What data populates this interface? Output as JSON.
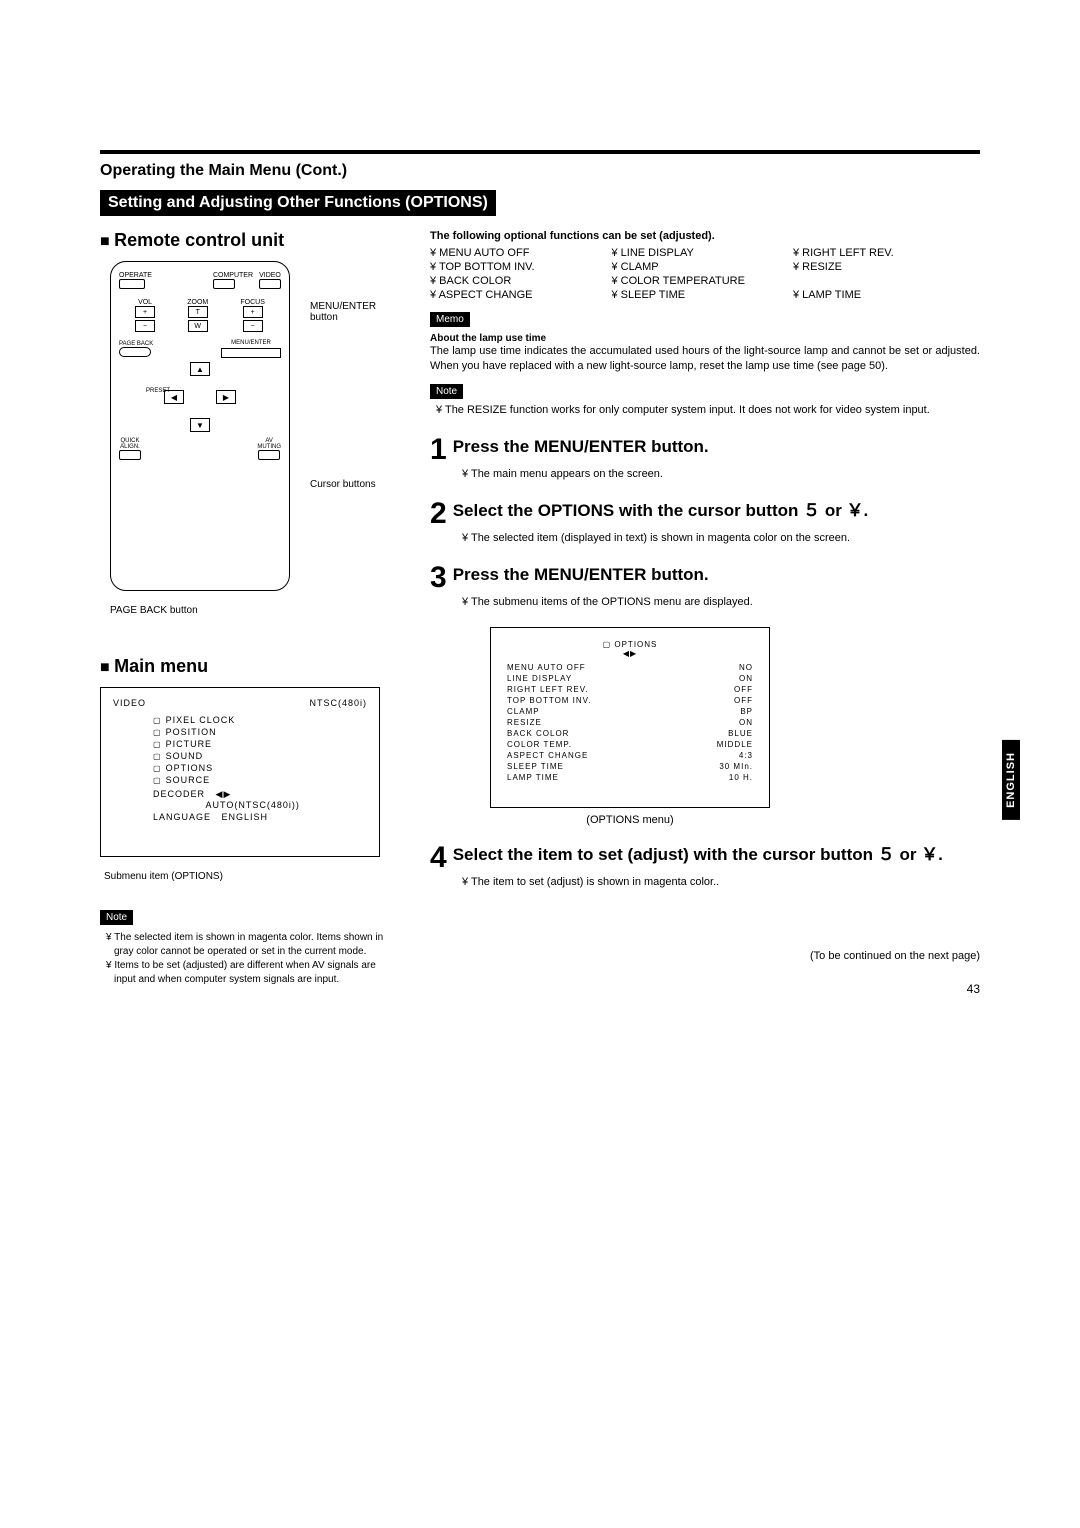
{
  "header": {
    "section_title": "Operating the Main Menu (Cont.)",
    "bar_title": "Setting and Adjusting Other Functions (OPTIONS)"
  },
  "remote": {
    "heading": "Remote control unit",
    "label_menu_enter": "MENU/ENTER button",
    "label_cursor": "Cursor buttons",
    "label_page_back": "PAGE BACK button",
    "btn": {
      "operate": "OPERATE",
      "computer": "COMPUTER",
      "video": "VIDEO",
      "vol": "VOL",
      "zoom": "ZOOM",
      "focus": "FOCUS",
      "plus": "+",
      "minus": "−",
      "t": "T",
      "w": "W",
      "page_back": "PAGE BACK",
      "menu_enter": "MENU/ENTER",
      "preset": "PRESET",
      "quick_align": "QUICK ALIGN.",
      "av_muting": "AV MUTING"
    }
  },
  "main_menu": {
    "heading": "Main menu",
    "top_left": "VIDEO",
    "top_right": "NTSC(480i)",
    "items": [
      "PIXEL CLOCK",
      "POSITION",
      "PICTURE",
      "SOUND",
      "OPTIONS",
      "SOURCE"
    ],
    "decoder_label": "DECODER",
    "decoder_value": "AUTO(NTSC(480i))",
    "language_label": "LANGUAGE",
    "language_value": "ENGLISH",
    "caption": "Submenu item (OPTIONS)"
  },
  "left_note": {
    "tag": "Note",
    "line1": "¥ The selected item is shown in magenta color. Items shown in gray color cannot be operated or set in the current mode.",
    "line2": "¥ Items to be set (adjusted) are different when AV signals are input and when computer system signals are input."
  },
  "right": {
    "intro": "The following optional functions can be set (adjusted).",
    "options": [
      "¥ MENU AUTO OFF",
      "¥ LINE DISPLAY",
      "¥ RIGHT LEFT REV.",
      "¥ TOP BOTTOM INV.",
      "¥ CLAMP",
      "¥ RESIZE",
      "¥ BACK COLOR",
      "¥ COLOR TEMPERATURE",
      "",
      "¥ ASPECT CHANGE",
      "¥ SLEEP TIME",
      "¥ LAMP TIME"
    ],
    "memo_tag": "Memo",
    "memo_head": "About the lamp use time",
    "memo_body": "The lamp use time indicates the accumulated used hours of the light-source lamp and cannot be set or adjusted. When you have replaced with a new light-source lamp, reset the lamp use time (see page 50).",
    "note_tag": "Note",
    "note_body": "¥ The RESIZE function works for only computer system input. It does not work for video system input.",
    "steps": {
      "s1_t": "Press the MENU/ENTER button.",
      "s1_b": "¥ The main menu appears on the screen.",
      "s2_t": "Select the  OPTIONS  with the cursor button ５ or ￥.",
      "s2_b": "¥ The selected item (displayed in text) is shown in magenta color on the screen.",
      "s3_t": "Press the MENU/ENTER button.",
      "s3_b": "¥ The submenu items of the OPTIONS menu are displayed.",
      "s4_t": "Select the item to set (adjust) with the cursor button ５ or ￥.",
      "s4_b": "¥ The item to set (adjust) is shown in magenta color.."
    },
    "opts_menu": {
      "title": "OPTIONS",
      "rows": [
        [
          "MENU AUTO OFF",
          "NO"
        ],
        [
          "LINE DISPLAY",
          "ON"
        ],
        [
          "RIGHT LEFT REV.",
          "OFF"
        ],
        [
          "TOP BOTTOM INV.",
          "OFF"
        ],
        [
          "CLAMP",
          "BP"
        ],
        [
          "RESIZE",
          "ON"
        ],
        [
          "BACK COLOR",
          "BLUE"
        ],
        [
          "COLOR TEMP.",
          "MIDDLE"
        ],
        [
          "ASPECT CHANGE",
          "4:3"
        ],
        [
          "SLEEP TIME",
          "30   MIn."
        ],
        [
          "LAMP TIME",
          "10   H."
        ]
      ],
      "caption": "(OPTIONS menu)"
    },
    "continued": "(To be continued on the next page)"
  },
  "side_tab": "ENGLISH",
  "page_number": "43"
}
